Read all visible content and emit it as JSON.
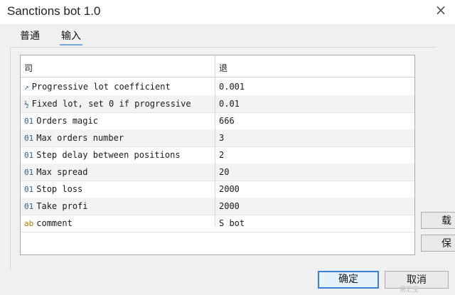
{
  "window": {
    "title": "Sanctions bot 1.0",
    "close_glyph": "×"
  },
  "tabs": [
    {
      "label": "普通",
      "selected": false
    },
    {
      "label": "输入",
      "selected": true
    }
  ],
  "grid": {
    "headers": {
      "variable": "司",
      "value": "退"
    },
    "rows": [
      {
        "icon": "pi-ratio-icon",
        "glyph": "↗",
        "variable": "Progressive lot coefficient",
        "value": "0.001"
      },
      {
        "icon": "fraction-icon",
        "glyph": "½",
        "variable": "Fixed lot, set 0 if progressive",
        "value": "0.01"
      },
      {
        "icon": "integer-icon",
        "glyph": "01",
        "variable": "Orders magic",
        "value": "666"
      },
      {
        "icon": "integer-icon",
        "glyph": "01",
        "variable": "Max orders number",
        "value": "3"
      },
      {
        "icon": "integer-icon",
        "glyph": "01",
        "variable": "Step delay between positions",
        "value": "2"
      },
      {
        "icon": "integer-icon",
        "glyph": "01",
        "variable": "Max spread",
        "value": "20"
      },
      {
        "icon": "integer-icon",
        "glyph": "01",
        "variable": "Stop loss",
        "value": "2000"
      },
      {
        "icon": "integer-icon",
        "glyph": "01",
        "variable": "Take profi",
        "value": "2000"
      },
      {
        "icon": "string-icon",
        "glyph": "ab",
        "variable": "comment",
        "value": "S        bot"
      }
    ]
  },
  "side_buttons": {
    "load": "载",
    "save": "保"
  },
  "buttons": {
    "ok": "确定",
    "cancel": "取消"
  },
  "watermark": "易汇宝"
}
